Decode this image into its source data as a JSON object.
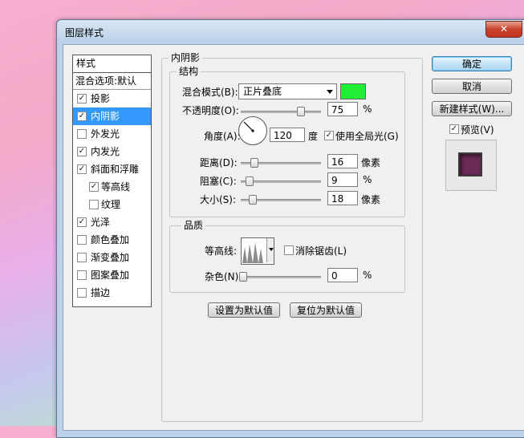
{
  "window": {
    "title": "图层样式",
    "close_icon": "close-icon"
  },
  "style_list": {
    "header": "样式",
    "blend_options": "混合选项:默认",
    "items": [
      {
        "label": "投影",
        "checked": true
      },
      {
        "label": "内阴影",
        "checked": true,
        "selected": true
      },
      {
        "label": "外发光",
        "checked": false
      },
      {
        "label": "内发光",
        "checked": true
      },
      {
        "label": "斜面和浮雕",
        "checked": true
      },
      {
        "label": "等高线",
        "checked": true,
        "sub": true
      },
      {
        "label": "纹理",
        "checked": false,
        "sub": true
      },
      {
        "label": "光泽",
        "checked": true
      },
      {
        "label": "颜色叠加",
        "checked": false
      },
      {
        "label": "渐变叠加",
        "checked": false
      },
      {
        "label": "图案叠加",
        "checked": false
      },
      {
        "label": "描边",
        "checked": false
      }
    ]
  },
  "panel": {
    "title": "内阴影",
    "structure": {
      "title": "结构",
      "blend_mode_label": "混合模式(B):",
      "blend_mode_value": "正片叠底",
      "color_swatch": "#22ee33",
      "opacity_label": "不透明度(O):",
      "opacity_value": "75",
      "opacity_unit": "%",
      "angle_label": "角度(A):",
      "angle_value": "120",
      "angle_unit": "度",
      "global_light_label": "使用全局光(G)",
      "global_light_checked": true,
      "distance_label": "距离(D):",
      "distance_value": "16",
      "distance_unit": "像素",
      "choke_label": "阻塞(C):",
      "choke_value": "9",
      "choke_unit": "%",
      "size_label": "大小(S):",
      "size_value": "18",
      "size_unit": "像素"
    },
    "quality": {
      "title": "品质",
      "contour_label": "等高线:",
      "antialias_label": "消除锯齿(L)",
      "antialias_checked": false,
      "noise_label": "杂色(N):",
      "noise_value": "0",
      "noise_unit": "%"
    },
    "set_default": "设置为默认值",
    "reset_default": "复位为默认值"
  },
  "actions": {
    "ok": "确定",
    "cancel": "取消",
    "new_style": "新建样式(W)...",
    "preview_label": "预览(V)",
    "preview_checked": true,
    "preview_color": "#6b2a55"
  }
}
